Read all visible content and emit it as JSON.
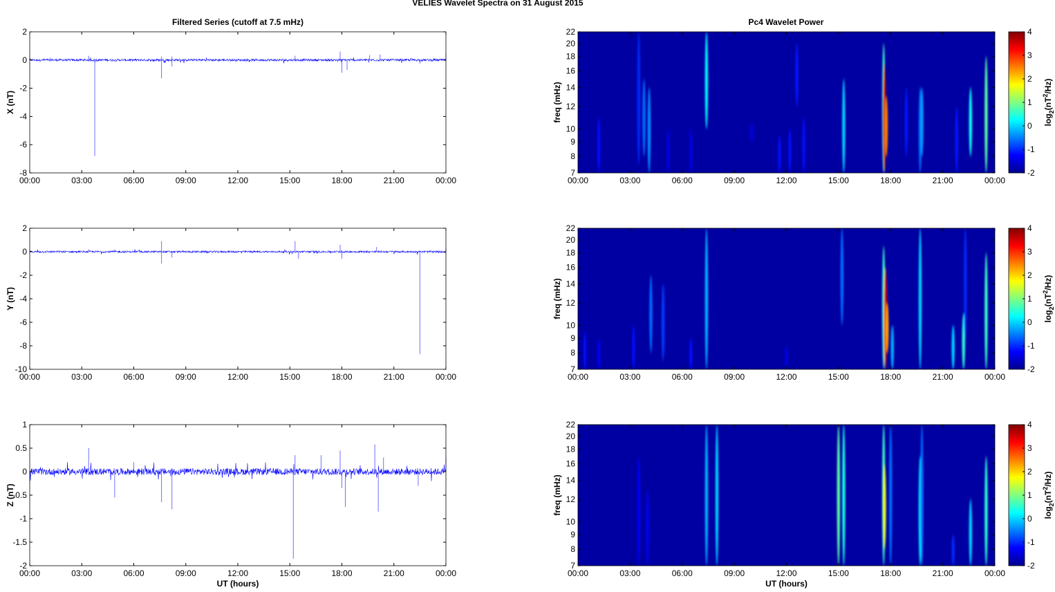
{
  "title": "VELIES Wavelet Spectra on 31 August    2015",
  "left_title": "Filtered Series (cutoff at 7.5 mHz)",
  "right_title": "Pc4 Wavelet Power",
  "chart_data": [
    {
      "type": "line",
      "panel": "series-x",
      "ylabel": "X (nT)",
      "ylim": [
        -8,
        2
      ],
      "yticks": [
        "2",
        "0",
        "-2",
        "-4",
        "-6",
        "-8"
      ],
      "ytick_values": [
        2,
        0,
        -2,
        -4,
        -6,
        -8
      ],
      "xlim": [
        0,
        24
      ],
      "xticks": [
        "00:00",
        "03:00",
        "06:00",
        "09:00",
        "12:00",
        "15:00",
        "18:00",
        "21:00",
        "00:00"
      ],
      "xlabel": "",
      "noise_amplitude": 0.08,
      "color": "#0000ff",
      "spikes": [
        [
          1.2,
          0.15
        ],
        [
          3.4,
          0.3
        ],
        [
          3.75,
          -6.8
        ],
        [
          7.6,
          -1.3
        ],
        [
          7.6,
          0.25
        ],
        [
          8.2,
          -0.45
        ],
        [
          8.2,
          0.25
        ],
        [
          15.3,
          0.3
        ],
        [
          17.9,
          0.6
        ],
        [
          18.0,
          -0.9
        ],
        [
          18.3,
          -0.7
        ],
        [
          19.6,
          0.35
        ],
        [
          20.2,
          0.4
        ],
        [
          22.5,
          -0.25
        ],
        [
          24,
          0.45
        ]
      ]
    },
    {
      "type": "line",
      "panel": "series-y",
      "ylabel": "Y (nT)",
      "ylim": [
        -10,
        2
      ],
      "yticks": [
        "2",
        "0",
        "-2",
        "-4",
        "-6",
        "-8",
        "-10"
      ],
      "ytick_values": [
        2,
        0,
        -2,
        -4,
        -6,
        -8,
        -10
      ],
      "xlim": [
        0,
        24
      ],
      "xticks": [
        "00:00",
        "03:00",
        "06:00",
        "09:00",
        "12:00",
        "15:00",
        "18:00",
        "21:00",
        "00:00"
      ],
      "xlabel": "",
      "noise_amplitude": 0.08,
      "color": "#0000ff",
      "spikes": [
        [
          3.4,
          0.2
        ],
        [
          4.9,
          0.2
        ],
        [
          7.6,
          0.9
        ],
        [
          7.6,
          -1.0
        ],
        [
          8.2,
          -0.5
        ],
        [
          15.3,
          0.9
        ],
        [
          15.5,
          -0.6
        ],
        [
          17.9,
          0.6
        ],
        [
          18.0,
          -0.6
        ],
        [
          20.0,
          0.4
        ],
        [
          22.5,
          -8.7
        ],
        [
          24,
          0.3
        ]
      ]
    },
    {
      "type": "line",
      "panel": "series-z",
      "ylabel": "Z (nT)",
      "ylim": [
        -2,
        1
      ],
      "yticks": [
        "1",
        "0.5",
        "0",
        "-0.5",
        "-1",
        "-1.5",
        "-2"
      ],
      "ytick_values": [
        1,
        0.5,
        0,
        -0.5,
        -1,
        -1.5,
        -2
      ],
      "xlim": [
        0,
        24
      ],
      "xticks": [
        "00:00",
        "03:00",
        "06:00",
        "09:00",
        "12:00",
        "15:00",
        "18:00",
        "21:00",
        "00:00"
      ],
      "xlabel": "UT (hours)",
      "noise_amplitude": 0.07,
      "color": "#0000ff",
      "spikes": [
        [
          3.4,
          0.5
        ],
        [
          4.9,
          -0.55
        ],
        [
          6.0,
          0.2
        ],
        [
          7.6,
          -0.65
        ],
        [
          8.2,
          -0.8
        ],
        [
          15.2,
          -1.85
        ],
        [
          15.3,
          0.35
        ],
        [
          16.8,
          0.35
        ],
        [
          17.9,
          0.45
        ],
        [
          18.0,
          -0.35
        ],
        [
          18.2,
          -0.75
        ],
        [
          19.9,
          0.58
        ],
        [
          20.1,
          -0.85
        ],
        [
          20.4,
          0.3
        ],
        [
          22.4,
          -0.3
        ],
        [
          24,
          0.3
        ]
      ]
    },
    {
      "type": "heatmap",
      "panel": "wavelet-x",
      "ylabel": "freq (mHz)",
      "yscale": "log",
      "ylim": [
        7,
        22
      ],
      "yticks": [
        "22",
        "20",
        "18",
        "16",
        "14",
        "12",
        "10",
        "9",
        "8",
        "7"
      ],
      "ytick_values": [
        22,
        20,
        18,
        16,
        14,
        12,
        10,
        9,
        8,
        7
      ],
      "xlim": [
        0,
        24
      ],
      "xticks": [
        "00:00",
        "03:00",
        "06:00",
        "09:00",
        "12:00",
        "15:00",
        "18:00",
        "21:00",
        "00:00"
      ],
      "xlabel": "",
      "colorbar": {
        "label": "log2(nT^2/Hz)",
        "range": [
          -2,
          4
        ],
        "ticks": [
          "4",
          "3",
          "2",
          "1",
          "0",
          "-1",
          "-2"
        ],
        "colormap": "jet"
      },
      "background_power": -1.8,
      "bursts": [
        [
          1.2,
          7,
          11,
          -1.2
        ],
        [
          3.5,
          7.5,
          22,
          -1.0
        ],
        [
          3.8,
          8,
          15,
          -0.6
        ],
        [
          4.1,
          7,
          14,
          -0.4
        ],
        [
          5.2,
          7,
          10,
          -1.4
        ],
        [
          6.5,
          7,
          10,
          -1.4
        ],
        [
          7.4,
          10,
          22,
          0.2
        ],
        [
          10.0,
          9,
          10.5,
          -1.4
        ],
        [
          11.6,
          7,
          9.5,
          -1.2
        ],
        [
          12.2,
          7,
          10,
          -1.2
        ],
        [
          12.6,
          12,
          20,
          -1.1
        ],
        [
          13.0,
          7,
          11,
          -1.2
        ],
        [
          15.3,
          7,
          15,
          0.0
        ],
        [
          17.6,
          7,
          20,
          0.6
        ],
        [
          17.65,
          7,
          17,
          3.5
        ],
        [
          17.75,
          8,
          13,
          2.5
        ],
        [
          18.9,
          8,
          14,
          -1.1
        ],
        [
          19.7,
          7,
          14,
          -0.6
        ],
        [
          19.8,
          8,
          14,
          -0.3
        ],
        [
          21.8,
          7,
          12,
          -1.1
        ],
        [
          22.6,
          8,
          14,
          0.3
        ],
        [
          23.5,
          7,
          18,
          0.8
        ]
      ]
    },
    {
      "type": "heatmap",
      "panel": "wavelet-y",
      "ylabel": "freq (mHz)",
      "yscale": "log",
      "ylim": [
        7,
        22
      ],
      "yticks": [
        "22",
        "20",
        "18",
        "16",
        "14",
        "12",
        "10",
        "9",
        "8",
        "7"
      ],
      "ytick_values": [
        22,
        20,
        18,
        16,
        14,
        12,
        10,
        9,
        8,
        7
      ],
      "xlim": [
        0,
        24
      ],
      "xticks": [
        "00:00",
        "03:00",
        "06:00",
        "09:00",
        "12:00",
        "15:00",
        "18:00",
        "21:00",
        "00:00"
      ],
      "xlabel": "",
      "colorbar": {
        "label": "log2(nT^2/Hz)",
        "range": [
          -2,
          4
        ],
        "ticks": [
          "4",
          "3",
          "2",
          "1",
          "0",
          "-1",
          "-2"
        ],
        "colormap": "jet"
      },
      "background_power": -1.8,
      "bursts": [
        [
          0.4,
          7,
          9.5,
          -1.2
        ],
        [
          1.2,
          7,
          9,
          -1.3
        ],
        [
          3.2,
          7,
          10,
          -1.2
        ],
        [
          4.2,
          8,
          15,
          -0.6
        ],
        [
          4.9,
          7.5,
          14,
          -0.9
        ],
        [
          6.5,
          7,
          9,
          -1.2
        ],
        [
          7.4,
          7,
          22,
          -0.2
        ],
        [
          12.0,
          7,
          8.5,
          -1.4
        ],
        [
          15.2,
          10,
          22,
          -0.6
        ],
        [
          17.6,
          7,
          19,
          0.6
        ],
        [
          17.7,
          7,
          16,
          3.3
        ],
        [
          17.8,
          8,
          12,
          2.3
        ],
        [
          18.1,
          7,
          10,
          -0.2
        ],
        [
          19.7,
          7,
          22,
          0.0
        ],
        [
          21.6,
          7,
          10,
          0.0
        ],
        [
          22.2,
          7,
          11,
          0.5
        ],
        [
          22.3,
          9,
          22,
          -1.0
        ],
        [
          23.5,
          7,
          18,
          0.6
        ]
      ]
    },
    {
      "type": "heatmap",
      "panel": "wavelet-z",
      "ylabel": "freq (mHz)",
      "yscale": "log",
      "ylim": [
        7,
        22
      ],
      "yticks": [
        "22",
        "20",
        "18",
        "16",
        "14",
        "12",
        "10",
        "9",
        "8",
        "7"
      ],
      "ytick_values": [
        22,
        20,
        18,
        16,
        14,
        12,
        10,
        9,
        8,
        7
      ],
      "xlim": [
        0,
        24
      ],
      "xticks": [
        "00:00",
        "03:00",
        "06:00",
        "09:00",
        "12:00",
        "15:00",
        "18:00",
        "21:00",
        "00:00"
      ],
      "xlabel": "UT (hours)",
      "colorbar": {
        "label": "log2(nT^2/Hz)",
        "range": [
          -2,
          4
        ],
        "ticks": [
          "4",
          "3",
          "2",
          "1",
          "0",
          "-1",
          "-2"
        ],
        "colormap": "jet"
      },
      "background_power": -1.8,
      "bursts": [
        [
          3.5,
          7,
          17,
          -1.3
        ],
        [
          4.0,
          7,
          13,
          -1.3
        ],
        [
          7.4,
          7,
          22,
          -0.2
        ],
        [
          8.0,
          7,
          22,
          0.0
        ],
        [
          15.0,
          7,
          22,
          0.8
        ],
        [
          15.3,
          7,
          22,
          0.4
        ],
        [
          17.6,
          7,
          22,
          0.6
        ],
        [
          17.65,
          8,
          16,
          1.6
        ],
        [
          18.0,
          7,
          22,
          -0.6
        ],
        [
          19.7,
          7,
          17,
          0.2
        ],
        [
          19.8,
          7,
          22,
          -0.6
        ],
        [
          21.6,
          7,
          9,
          -1.0
        ],
        [
          22.6,
          7,
          12,
          0.0
        ],
        [
          23.5,
          7,
          17,
          0.5
        ]
      ]
    }
  ]
}
